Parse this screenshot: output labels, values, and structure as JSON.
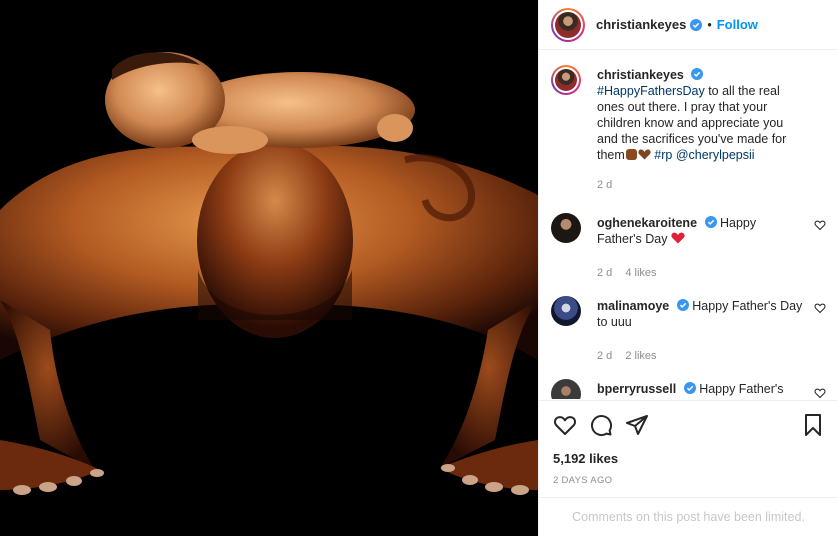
{
  "header": {
    "username": "christiankeyes",
    "separator": "•",
    "follow_label": "Follow"
  },
  "caption": {
    "username": "christiankeyes",
    "hashtag": "#HappyFathersDay",
    "text": "to all the real ones out there. I pray that your children know and appreciate you and the sacrifices you've made for them",
    "hashtag2": "#rp",
    "mention": "@cherylpepsii",
    "time": "2 d"
  },
  "comments": [
    {
      "username": "oghenekaroitene",
      "text": "Happy Father's Day",
      "time": "2 d",
      "likes": "4 likes"
    },
    {
      "username": "malinamoye",
      "text": "Happy Father's Day to uuu",
      "time": "2 d",
      "likes": "2 likes"
    },
    {
      "username": "bperryrussell",
      "text": "Happy Father's Day"
    }
  ],
  "footer": {
    "likes": "5,192 likes",
    "time_ago": "2 DAYS AGO",
    "comments_limited": "Comments on this post have been limited."
  },
  "icons": {
    "like": "heart-icon",
    "comment": "comment-icon",
    "share": "share-icon",
    "save": "bookmark-icon",
    "verified": "verified-badge-icon"
  },
  "colors": {
    "link": "#0095f6",
    "tag": "#00376b",
    "verified": "#3897f0",
    "heart_red": "#ed4956",
    "muted": "#8e8e8e"
  }
}
